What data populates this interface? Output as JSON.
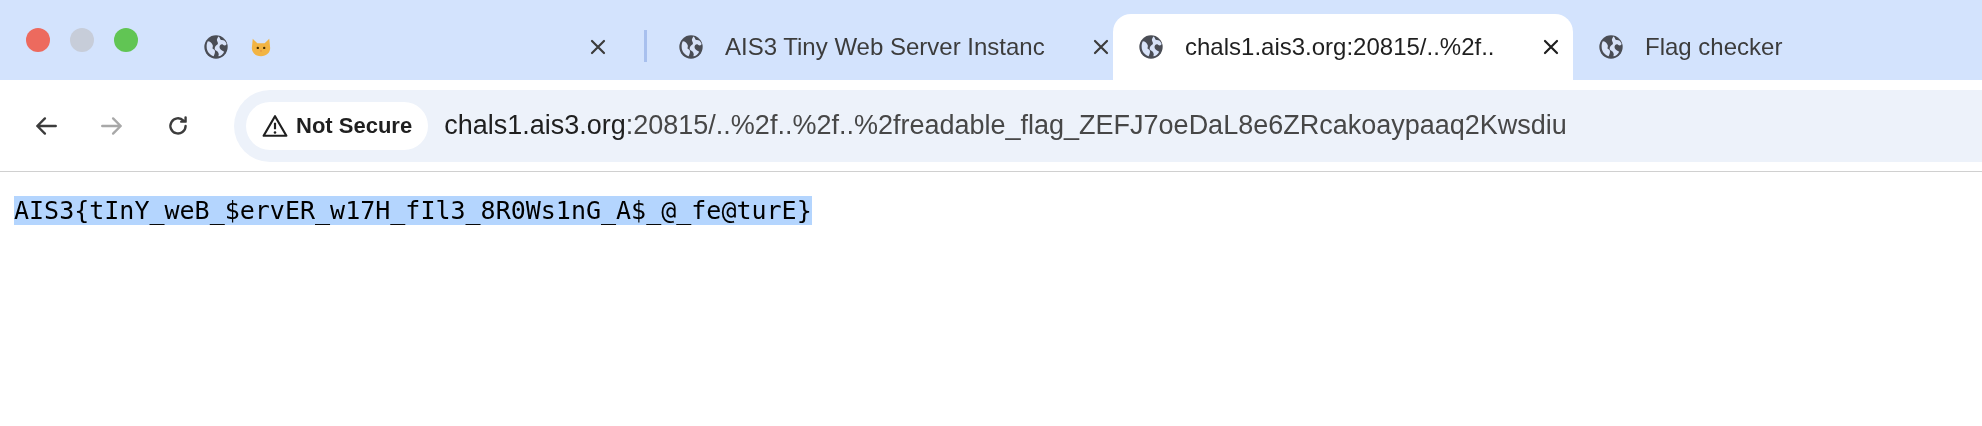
{
  "tabs": [
    {
      "selected": false
    },
    {
      "title": "AIS3 Tiny Web Server Instanc",
      "selected": false
    },
    {
      "title": "chals1.ais3.org:20815/..%2f..",
      "selected": true
    },
    {
      "title": "Flag checker",
      "selected": false
    }
  ],
  "toolbar": {
    "forward_disabled": true,
    "security_label": "Not Secure",
    "url_host": "chals1.ais3.org",
    "url_rest": ":20815/..%2f..%2f..%2freadable_flag_ZEFJ7oeDaL8e6ZRcakoaypaaq2Kwsdiu"
  },
  "page": {
    "text": "AIS3{tInY_weB_$ervER_w17H_fIl3_8R0Ws1nG_A$_@_fe@turE}",
    "highlighted": true
  }
}
